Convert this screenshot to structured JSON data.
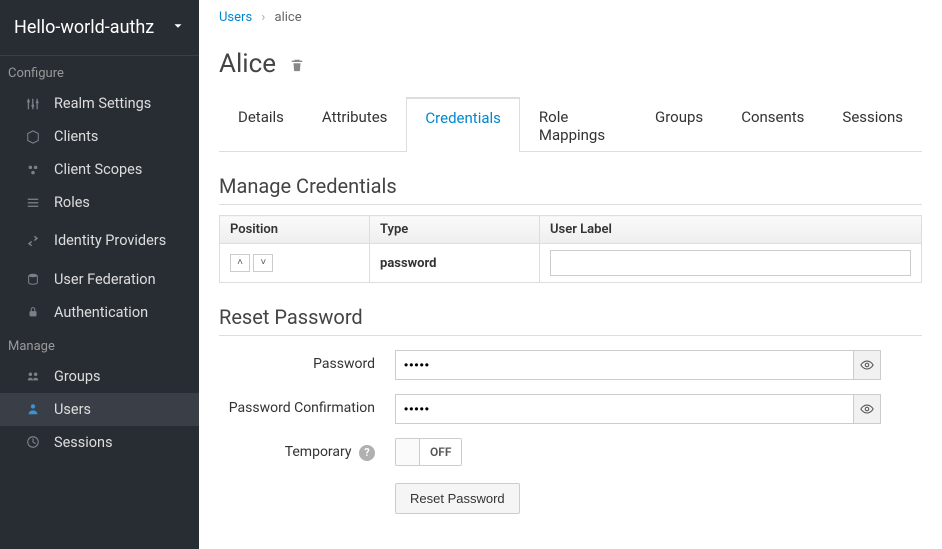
{
  "realm": {
    "name": "Hello-world-authz"
  },
  "sidebar": {
    "configure_label": "Configure",
    "manage_label": "Manage",
    "configure": [
      {
        "label": "Realm Settings",
        "icon": "sliders-icon"
      },
      {
        "label": "Clients",
        "icon": "cube-icon"
      },
      {
        "label": "Client Scopes",
        "icon": "scopes-icon"
      },
      {
        "label": "Roles",
        "icon": "list-icon"
      },
      {
        "label": "Identity Providers",
        "icon": "exchange-icon"
      },
      {
        "label": "User Federation",
        "icon": "database-icon"
      },
      {
        "label": "Authentication",
        "icon": "lock-icon"
      }
    ],
    "manage": [
      {
        "label": "Groups",
        "icon": "group-icon",
        "active": false
      },
      {
        "label": "Users",
        "icon": "user-icon",
        "active": true
      },
      {
        "label": "Sessions",
        "icon": "clock-icon",
        "active": false
      }
    ]
  },
  "breadcrumb": {
    "root": "Users",
    "current": "alice"
  },
  "page": {
    "title": "Alice"
  },
  "tabs": [
    {
      "label": "Details",
      "active": false
    },
    {
      "label": "Attributes",
      "active": false
    },
    {
      "label": "Credentials",
      "active": true
    },
    {
      "label": "Role Mappings",
      "active": false
    },
    {
      "label": "Groups",
      "active": false
    },
    {
      "label": "Consents",
      "active": false
    },
    {
      "label": "Sessions",
      "active": false
    }
  ],
  "manage_credentials": {
    "heading": "Manage Credentials",
    "columns": {
      "position": "Position",
      "type": "Type",
      "user_label": "User Label"
    },
    "rows": [
      {
        "type": "password",
        "user_label": ""
      }
    ]
  },
  "reset_password": {
    "heading": "Reset Password",
    "password_label": "Password",
    "password_value": "•••••",
    "confirm_label": "Password Confirmation",
    "confirm_value": "•••••",
    "temporary_label": "Temporary",
    "temporary_value": "OFF",
    "button": "Reset Password"
  }
}
